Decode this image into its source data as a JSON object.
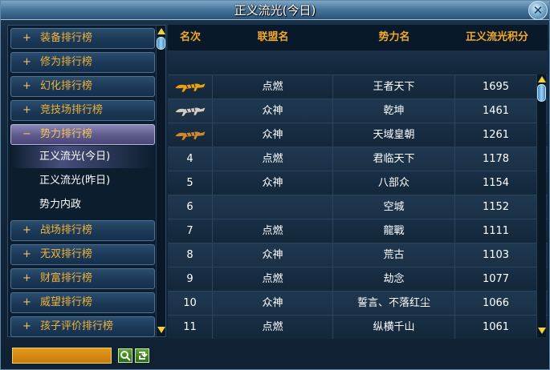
{
  "window": {
    "title": "正义流光(今日)",
    "close_glyph": "✕"
  },
  "menu": {
    "items": [
      {
        "sign": "+",
        "label": "装备排行榜"
      },
      {
        "sign": "+",
        "label": "修为排行榜"
      },
      {
        "sign": "+",
        "label": "幻化排行榜"
      },
      {
        "sign": "+",
        "label": "竞技场排行榜"
      },
      {
        "sign": "−",
        "label": "势力排行榜"
      },
      {
        "sign": "+",
        "label": "战场排行榜"
      },
      {
        "sign": "+",
        "label": "无双排行榜"
      },
      {
        "sign": "+",
        "label": "财富排行榜"
      },
      {
        "sign": "+",
        "label": "威望排行榜"
      },
      {
        "sign": "+",
        "label": "孩子评价排行榜"
      }
    ],
    "sub_items": [
      {
        "label": "正义流光(今日)"
      },
      {
        "label": "正义流光(昨日)"
      },
      {
        "label": "势力内政"
      }
    ]
  },
  "table": {
    "headers": [
      "名次",
      "联盟名",
      "势力名",
      "正义流光积分"
    ],
    "rows": [
      {
        "rank": "",
        "rank_icon": "gold-tiger-icon",
        "alliance": "点燃",
        "faction": "王者天下",
        "score": "1695"
      },
      {
        "rank": "",
        "rank_icon": "silver-tiger-icon",
        "alliance": "众神",
        "faction": "乾坤",
        "score": "1461"
      },
      {
        "rank": "",
        "rank_icon": "bronze-tiger-icon",
        "alliance": "众神",
        "faction": "天域皇朝",
        "score": "1261"
      },
      {
        "rank": "4",
        "rank_icon": "",
        "alliance": "点燃",
        "faction": "君临天下",
        "score": "1178"
      },
      {
        "rank": "5",
        "rank_icon": "",
        "alliance": "众神",
        "faction": "八部众",
        "score": "1154"
      },
      {
        "rank": "6",
        "rank_icon": "",
        "alliance": "",
        "faction": "空城",
        "score": "1152"
      },
      {
        "rank": "7",
        "rank_icon": "",
        "alliance": "点燃",
        "faction": "龍戰",
        "score": "1111"
      },
      {
        "rank": "8",
        "rank_icon": "",
        "alliance": "众神",
        "faction": "荒古",
        "score": "1103"
      },
      {
        "rank": "9",
        "rank_icon": "",
        "alliance": "点燃",
        "faction": "劫念",
        "score": "1077"
      },
      {
        "rank": "10",
        "rank_icon": "",
        "alliance": "众神",
        "faction": "誓言、不落红尘",
        "score": "1066"
      },
      {
        "rank": "11",
        "rank_icon": "",
        "alliance": "点燃",
        "faction": "纵横千山",
        "score": "1061"
      }
    ]
  },
  "colors": {
    "gold": "#e0a21f",
    "silver": "#c9cdd4",
    "bronze": "#c98a3a"
  }
}
